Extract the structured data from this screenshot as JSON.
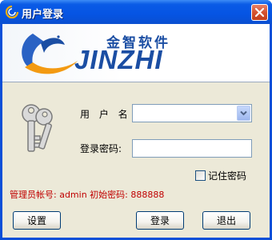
{
  "window": {
    "title": "用户登录",
    "accent": "#0a4fd8"
  },
  "banner": {
    "brand_cn": "金智软件",
    "brand_en": "JINZHI"
  },
  "form": {
    "username_label": "用 户 名:",
    "username_value": "",
    "password_label": "登录密码:",
    "password_value": "",
    "remember_label": "记住密码",
    "remember_checked": false
  },
  "hint": {
    "text": "管理员帐号: admin  初始密码: 888888",
    "color": "#c00000"
  },
  "buttons": {
    "settings": "设置",
    "login": "登录",
    "exit": "退出"
  },
  "icons": {
    "app": "app-logo-icon",
    "close": "close-icon",
    "keys": "keys-icon",
    "dropdown": "chevron-down-icon"
  }
}
